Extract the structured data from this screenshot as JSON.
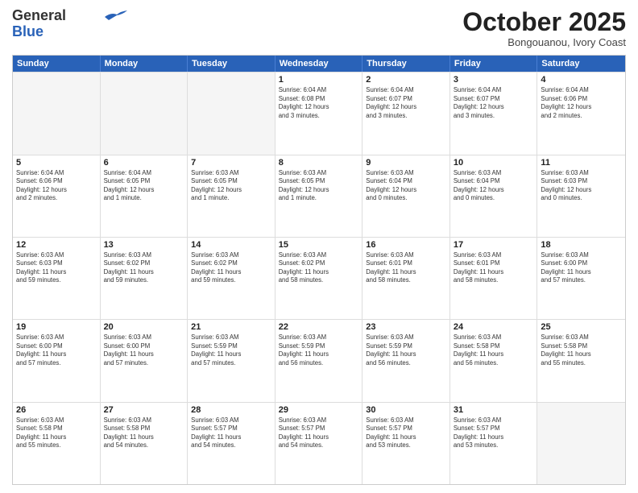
{
  "header": {
    "logo_line1": "General",
    "logo_line2": "Blue",
    "month": "October 2025",
    "location": "Bongouanou, Ivory Coast"
  },
  "weekdays": [
    "Sunday",
    "Monday",
    "Tuesday",
    "Wednesday",
    "Thursday",
    "Friday",
    "Saturday"
  ],
  "rows": [
    [
      {
        "day": "",
        "info": "",
        "empty": true
      },
      {
        "day": "",
        "info": "",
        "empty": true
      },
      {
        "day": "",
        "info": "",
        "empty": true
      },
      {
        "day": "1",
        "info": "Sunrise: 6:04 AM\nSunset: 6:08 PM\nDaylight: 12 hours\nand 3 minutes."
      },
      {
        "day": "2",
        "info": "Sunrise: 6:04 AM\nSunset: 6:07 PM\nDaylight: 12 hours\nand 3 minutes."
      },
      {
        "day": "3",
        "info": "Sunrise: 6:04 AM\nSunset: 6:07 PM\nDaylight: 12 hours\nand 3 minutes."
      },
      {
        "day": "4",
        "info": "Sunrise: 6:04 AM\nSunset: 6:06 PM\nDaylight: 12 hours\nand 2 minutes."
      }
    ],
    [
      {
        "day": "5",
        "info": "Sunrise: 6:04 AM\nSunset: 6:06 PM\nDaylight: 12 hours\nand 2 minutes."
      },
      {
        "day": "6",
        "info": "Sunrise: 6:04 AM\nSunset: 6:05 PM\nDaylight: 12 hours\nand 1 minute."
      },
      {
        "day": "7",
        "info": "Sunrise: 6:03 AM\nSunset: 6:05 PM\nDaylight: 12 hours\nand 1 minute."
      },
      {
        "day": "8",
        "info": "Sunrise: 6:03 AM\nSunset: 6:05 PM\nDaylight: 12 hours\nand 1 minute."
      },
      {
        "day": "9",
        "info": "Sunrise: 6:03 AM\nSunset: 6:04 PM\nDaylight: 12 hours\nand 0 minutes."
      },
      {
        "day": "10",
        "info": "Sunrise: 6:03 AM\nSunset: 6:04 PM\nDaylight: 12 hours\nand 0 minutes."
      },
      {
        "day": "11",
        "info": "Sunrise: 6:03 AM\nSunset: 6:03 PM\nDaylight: 12 hours\nand 0 minutes."
      }
    ],
    [
      {
        "day": "12",
        "info": "Sunrise: 6:03 AM\nSunset: 6:03 PM\nDaylight: 11 hours\nand 59 minutes."
      },
      {
        "day": "13",
        "info": "Sunrise: 6:03 AM\nSunset: 6:02 PM\nDaylight: 11 hours\nand 59 minutes."
      },
      {
        "day": "14",
        "info": "Sunrise: 6:03 AM\nSunset: 6:02 PM\nDaylight: 11 hours\nand 59 minutes."
      },
      {
        "day": "15",
        "info": "Sunrise: 6:03 AM\nSunset: 6:02 PM\nDaylight: 11 hours\nand 58 minutes."
      },
      {
        "day": "16",
        "info": "Sunrise: 6:03 AM\nSunset: 6:01 PM\nDaylight: 11 hours\nand 58 minutes."
      },
      {
        "day": "17",
        "info": "Sunrise: 6:03 AM\nSunset: 6:01 PM\nDaylight: 11 hours\nand 58 minutes."
      },
      {
        "day": "18",
        "info": "Sunrise: 6:03 AM\nSunset: 6:00 PM\nDaylight: 11 hours\nand 57 minutes."
      }
    ],
    [
      {
        "day": "19",
        "info": "Sunrise: 6:03 AM\nSunset: 6:00 PM\nDaylight: 11 hours\nand 57 minutes."
      },
      {
        "day": "20",
        "info": "Sunrise: 6:03 AM\nSunset: 6:00 PM\nDaylight: 11 hours\nand 57 minutes."
      },
      {
        "day": "21",
        "info": "Sunrise: 6:03 AM\nSunset: 5:59 PM\nDaylight: 11 hours\nand 57 minutes."
      },
      {
        "day": "22",
        "info": "Sunrise: 6:03 AM\nSunset: 5:59 PM\nDaylight: 11 hours\nand 56 minutes."
      },
      {
        "day": "23",
        "info": "Sunrise: 6:03 AM\nSunset: 5:59 PM\nDaylight: 11 hours\nand 56 minutes."
      },
      {
        "day": "24",
        "info": "Sunrise: 6:03 AM\nSunset: 5:58 PM\nDaylight: 11 hours\nand 56 minutes."
      },
      {
        "day": "25",
        "info": "Sunrise: 6:03 AM\nSunset: 5:58 PM\nDaylight: 11 hours\nand 55 minutes."
      }
    ],
    [
      {
        "day": "26",
        "info": "Sunrise: 6:03 AM\nSunset: 5:58 PM\nDaylight: 11 hours\nand 55 minutes."
      },
      {
        "day": "27",
        "info": "Sunrise: 6:03 AM\nSunset: 5:58 PM\nDaylight: 11 hours\nand 54 minutes."
      },
      {
        "day": "28",
        "info": "Sunrise: 6:03 AM\nSunset: 5:57 PM\nDaylight: 11 hours\nand 54 minutes."
      },
      {
        "day": "29",
        "info": "Sunrise: 6:03 AM\nSunset: 5:57 PM\nDaylight: 11 hours\nand 54 minutes."
      },
      {
        "day": "30",
        "info": "Sunrise: 6:03 AM\nSunset: 5:57 PM\nDaylight: 11 hours\nand 53 minutes."
      },
      {
        "day": "31",
        "info": "Sunrise: 6:03 AM\nSunset: 5:57 PM\nDaylight: 11 hours\nand 53 minutes."
      },
      {
        "day": "",
        "info": "",
        "empty": true
      }
    ]
  ]
}
